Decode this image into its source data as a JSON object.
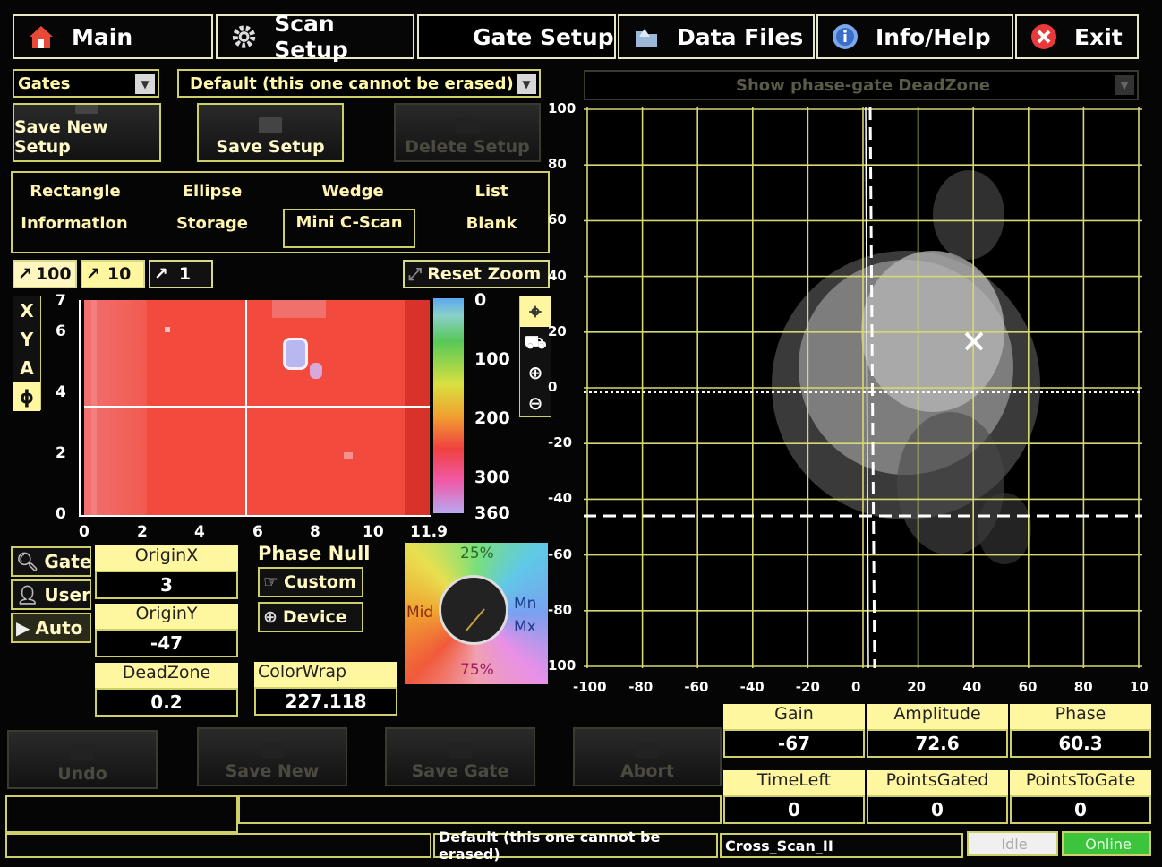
{
  "tabs": [
    {
      "label": "Main",
      "icon": "home-icon"
    },
    {
      "label": "Scan Setup",
      "icon": "gear-icon"
    },
    {
      "label": "Gate Setup",
      "icon": "blank-icon"
    },
    {
      "label": "Data Files",
      "icon": "folder-icon"
    },
    {
      "label": "Info/Help",
      "icon": "info-icon"
    },
    {
      "label": "Exit",
      "icon": "close-icon"
    }
  ],
  "setup": {
    "type_select": "Gates",
    "setup_select": "Default (this one cannot be erased)",
    "save_new": "Save New Setup",
    "save": "Save Setup",
    "delete": "Delete Setup"
  },
  "shapes": [
    "Rectangle",
    "Ellipse",
    "Wedge",
    "List",
    "Information",
    "Storage",
    "Mini C-Scan",
    "Blank"
  ],
  "zoom": {
    "z100": "100",
    "z10": "10",
    "z1": "1",
    "reset": "Reset Zoom"
  },
  "axis_selector": [
    "X",
    "Y",
    "A",
    "ϕ"
  ],
  "cscan": {
    "y_ticks": [
      "7",
      "6",
      "4",
      "2",
      "0"
    ],
    "x_ticks": [
      "0",
      "2",
      "4",
      "6",
      "8",
      "10",
      "11.9"
    ],
    "scale_ticks": [
      "0",
      "100",
      "200",
      "300",
      "360"
    ]
  },
  "gate_modes": {
    "gate": "Gate",
    "user": "User",
    "auto": "Auto"
  },
  "params": {
    "originx_label": "OriginX",
    "originx": "3",
    "originy_label": "OriginY",
    "originy": "-47",
    "deadzone_label": "DeadZone",
    "deadzone": "0.2",
    "phasenull_label": "Phase Null",
    "custom": "Custom",
    "device": "Device",
    "colorwrap_label": "ColorWrap",
    "colorwrap": "227.118"
  },
  "dial": {
    "top": "25%",
    "bottom": "75%",
    "left": "Mid",
    "right1": "Mn",
    "right2": "Mx"
  },
  "actions": {
    "undo": "Undo",
    "save_new": "Save New",
    "save_gate": "Save Gate",
    "abort": "Abort"
  },
  "plot": {
    "deadzone_select": "Show phase-gate DeadZone",
    "y_ticks": [
      "100",
      "80",
      "60",
      "40",
      "20",
      "0",
      "-20",
      "-40",
      "-60",
      "-80",
      "100"
    ],
    "x_ticks": [
      "-100",
      "-80",
      "-60",
      "-40",
      "-20",
      "0",
      "20",
      "40",
      "60",
      "80",
      "10"
    ]
  },
  "readouts": {
    "gain_label": "Gain",
    "gain": "-67",
    "amplitude_label": "Amplitude",
    "amplitude": "72.6",
    "phase_label": "Phase",
    "phase": "60.3",
    "timeleft_label": "TimeLeft",
    "timeleft": "0",
    "pointsgated_label": "PointsGated",
    "pointsgated": "0",
    "pointstogate_label": "PointsToGate",
    "pointstogate": "0"
  },
  "statusbar": {
    "setup": "Default (this one cannot be erased)",
    "file": "Cross_Scan_II",
    "state": "Idle",
    "connection": "Online"
  },
  "colors": {
    "accent": "#cfcf6a",
    "label_bg": "#fff6a0",
    "online": "#3cc43c",
    "cscan_red": "#f24a3c"
  }
}
